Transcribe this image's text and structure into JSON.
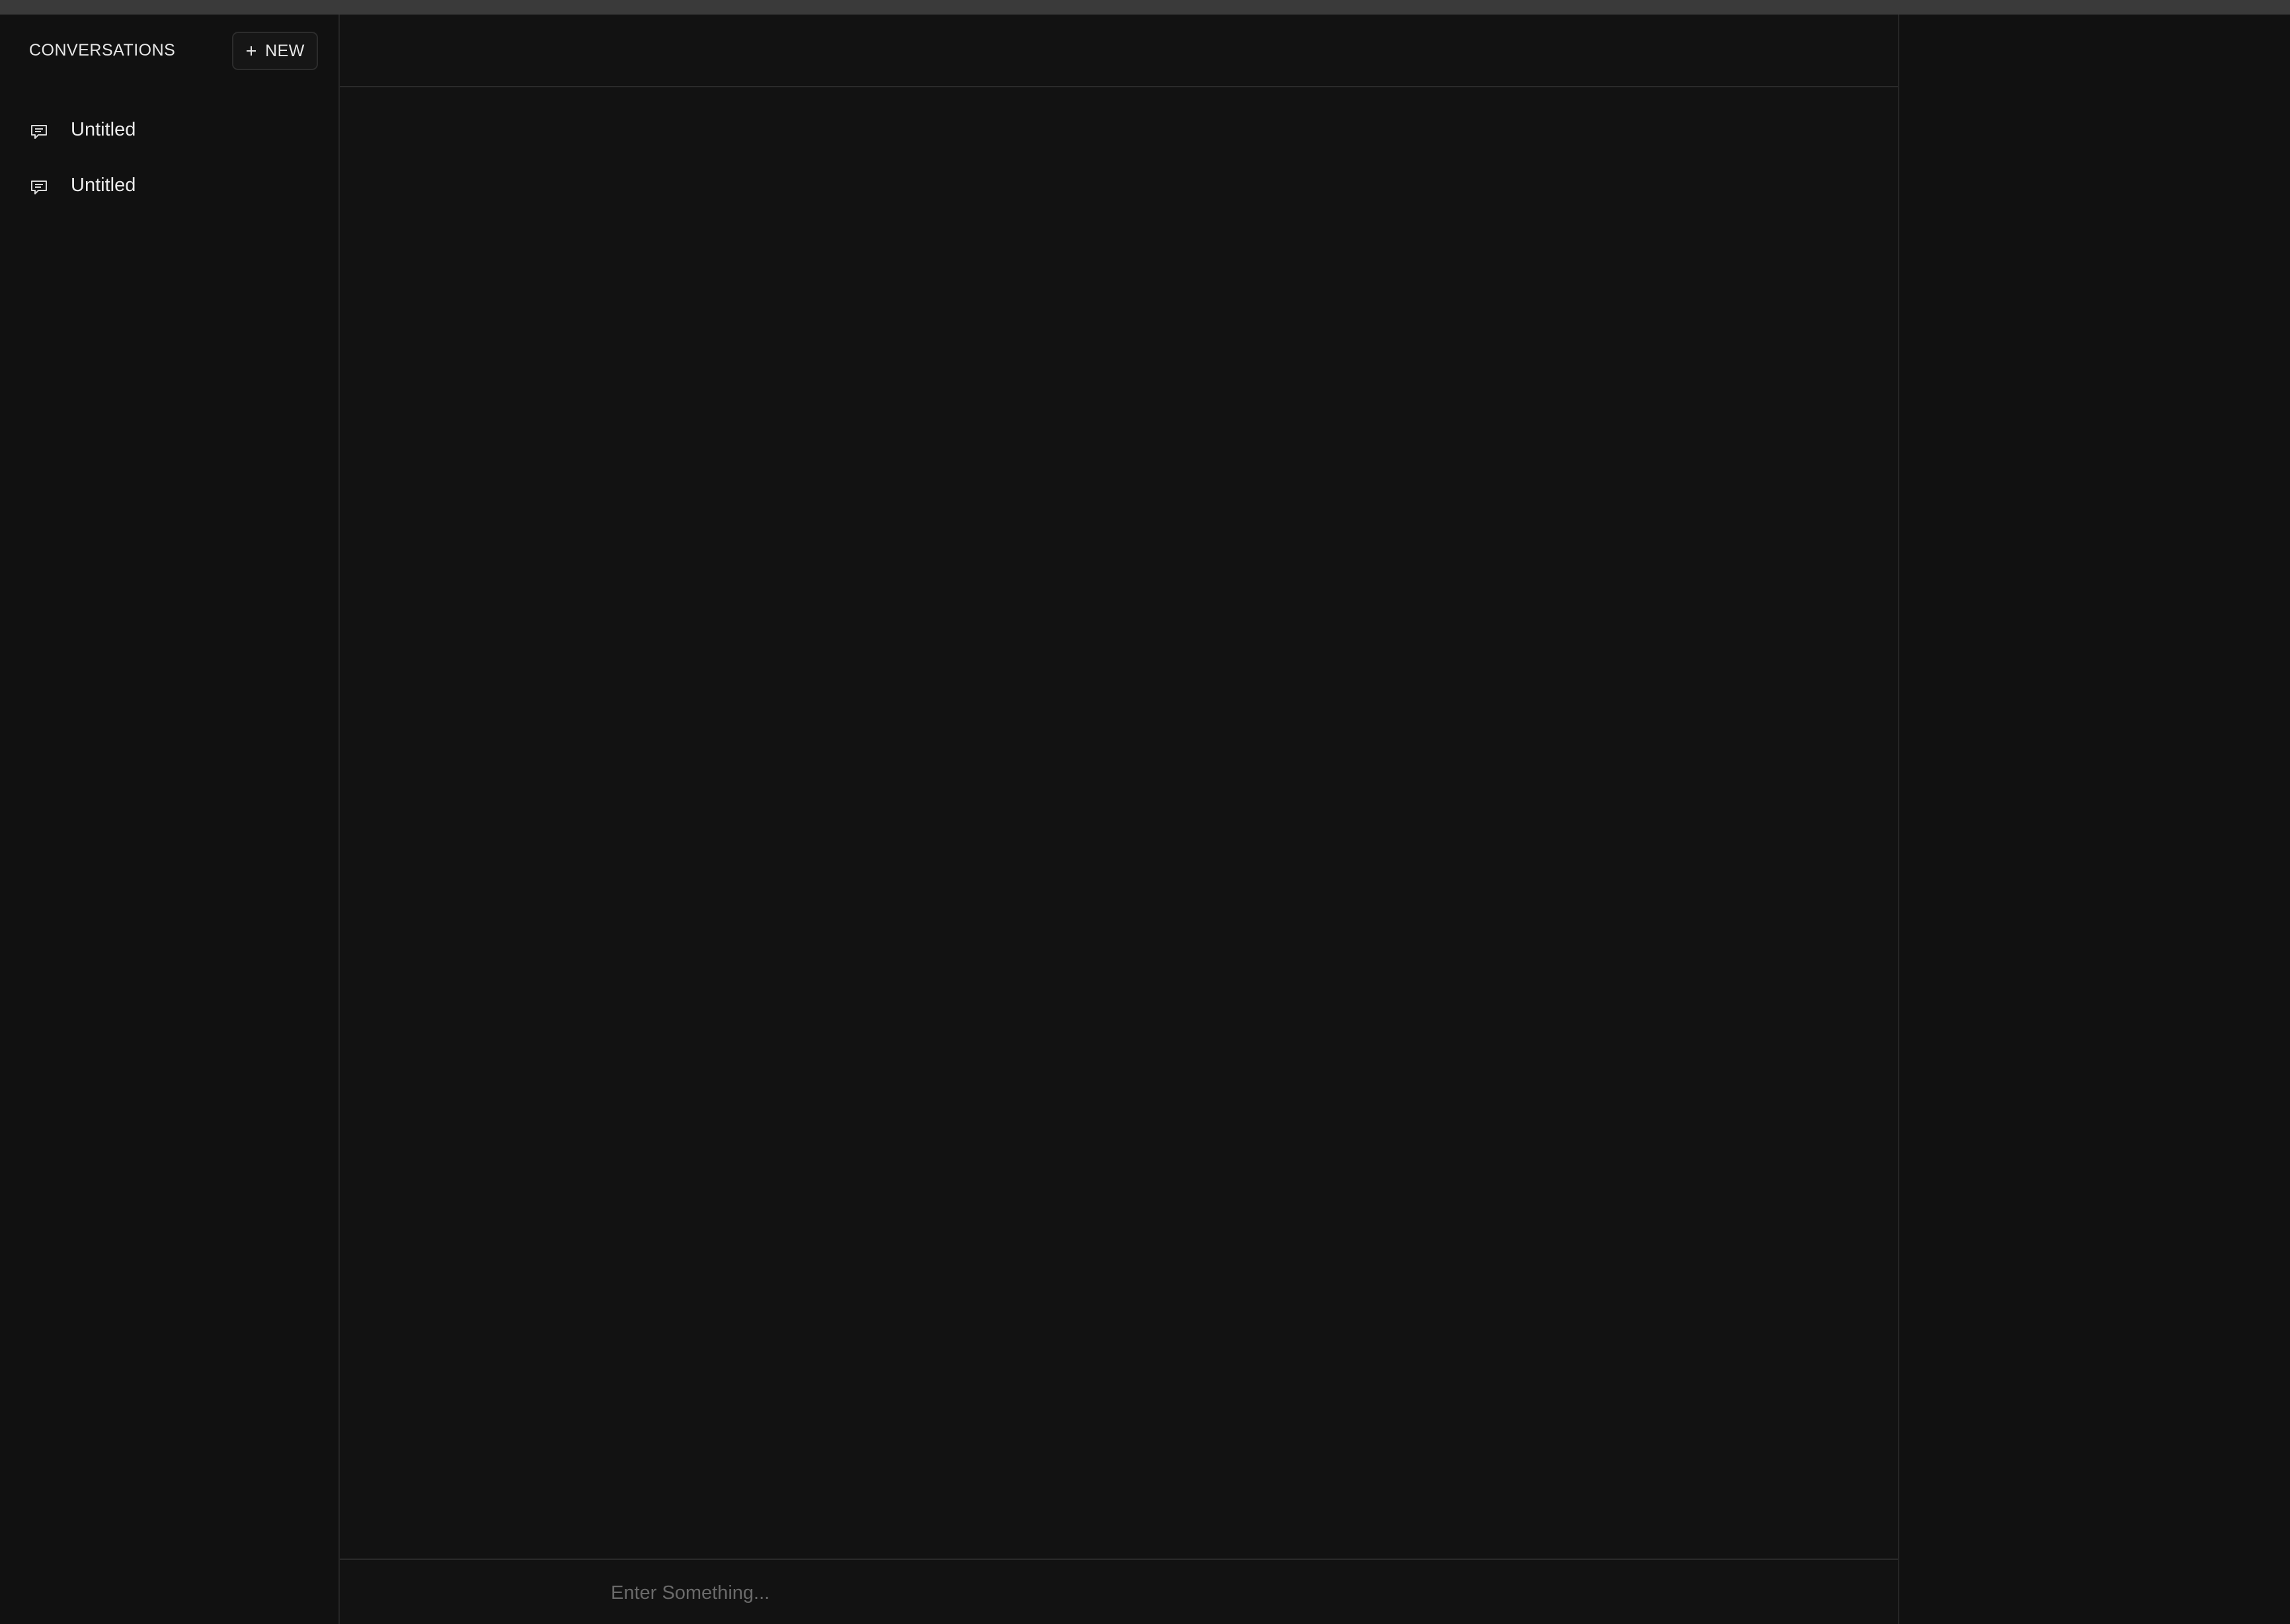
{
  "sidebar": {
    "title": "CONVERSATIONS",
    "new_button_label": "NEW",
    "items": [
      {
        "label": "Untitled",
        "icon": "chat-bubble-icon"
      },
      {
        "label": "Untitled",
        "icon": "chat-bubble-icon"
      }
    ]
  },
  "composer": {
    "placeholder": "Enter Something...",
    "value": ""
  },
  "colors": {
    "background": "#111111",
    "topbar": "#3a3a3a",
    "border": "#262626",
    "text": "#e6e6e6",
    "placeholder": "#6a6a6a"
  }
}
